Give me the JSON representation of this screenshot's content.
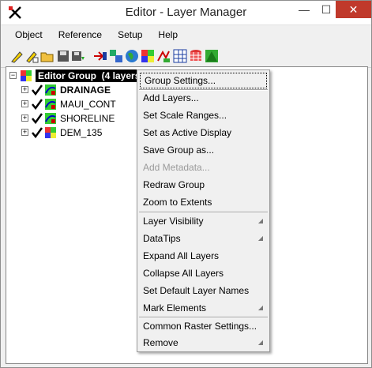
{
  "window": {
    "title": "Editor - Layer Manager"
  },
  "menubar": {
    "items": [
      "Object",
      "Reference",
      "Setup",
      "Help"
    ]
  },
  "toolbar": {
    "icons": [
      "draw-icon",
      "edit-icon",
      "open-folder-icon",
      "save-icon",
      "save-as-icon",
      "add-layer-icon",
      "layer-controls-icon",
      "globe-icon",
      "raster-icon",
      "vector-icon",
      "grid-icon",
      "database-icon",
      "map-icon"
    ]
  },
  "tree": {
    "group": {
      "label": "Editor Group",
      "count": "(4 layers)"
    },
    "layers": [
      {
        "name": "DRAINAGE",
        "bold": true
      },
      {
        "name": "MAUI_CONT",
        "bold": false
      },
      {
        "name": "SHORELINE",
        "bold": false
      },
      {
        "name": "DEM_135",
        "bold": false
      }
    ]
  },
  "context_menu": {
    "items": [
      {
        "label": "Group Settings...",
        "disabled": false,
        "submenu": false
      },
      {
        "label": "Add Layers...",
        "disabled": false,
        "submenu": false
      },
      {
        "label": "Set Scale Ranges...",
        "disabled": false,
        "submenu": false
      },
      {
        "label": "Set as Active Display",
        "disabled": false,
        "submenu": false
      },
      {
        "label": "Save Group as...",
        "disabled": false,
        "submenu": false
      },
      {
        "label": "Add Metadata...",
        "disabled": true,
        "submenu": false
      },
      {
        "label": "Redraw Group",
        "disabled": false,
        "submenu": false
      },
      {
        "label": "Zoom to Extents",
        "disabled": false,
        "submenu": false
      },
      {
        "label": "Layer Visibility",
        "disabled": false,
        "submenu": true
      },
      {
        "label": "DataTips",
        "disabled": false,
        "submenu": true
      },
      {
        "label": "Expand All Layers",
        "disabled": false,
        "submenu": false
      },
      {
        "label": "Collapse All Layers",
        "disabled": false,
        "submenu": false
      },
      {
        "label": "Set Default Layer Names",
        "disabled": false,
        "submenu": false
      },
      {
        "label": "Mark Elements",
        "disabled": false,
        "submenu": true
      },
      {
        "label": "Common Raster Settings...",
        "disabled": false,
        "submenu": false
      },
      {
        "label": "Remove",
        "disabled": false,
        "submenu": true
      }
    ]
  },
  "colors": {
    "window_bg": "#f0f0f0",
    "close_button": "#c0392b",
    "group_highlight": "#000000"
  }
}
